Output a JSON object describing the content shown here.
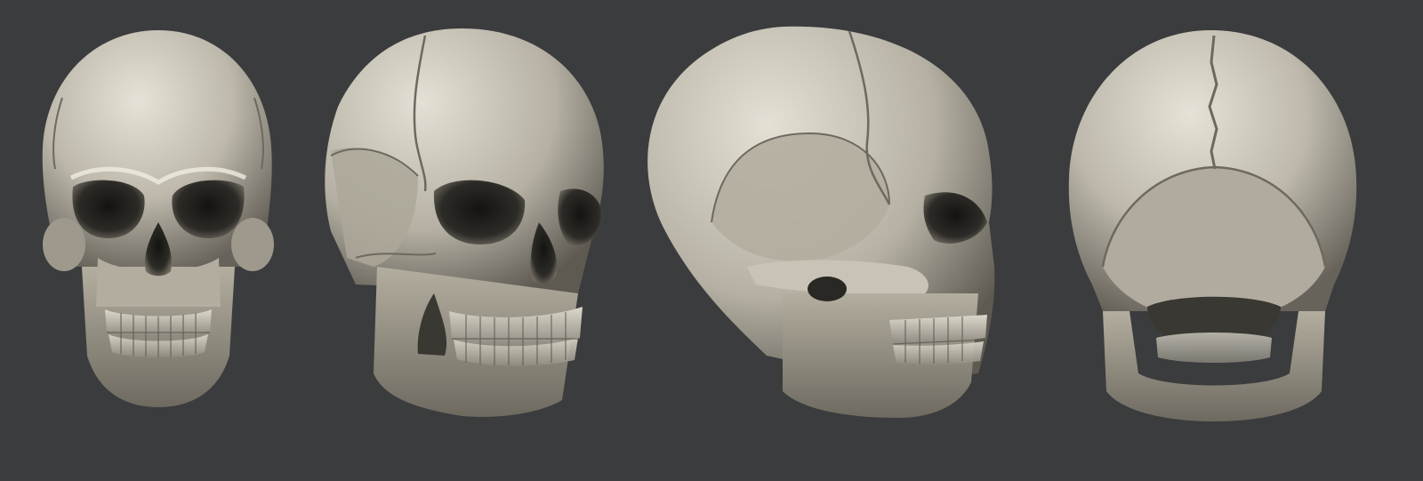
{
  "scene": {
    "background": "#3b3c3e",
    "bone_light": "#e3dfd4",
    "bone_mid": "#aaa597",
    "bone_dark": "#4a4740",
    "cavity": "#22211e"
  },
  "views": [
    {
      "id": "front",
      "label": ""
    },
    {
      "id": "three-quarter",
      "label": ""
    },
    {
      "id": "side",
      "label": ""
    },
    {
      "id": "back",
      "label": ""
    }
  ]
}
